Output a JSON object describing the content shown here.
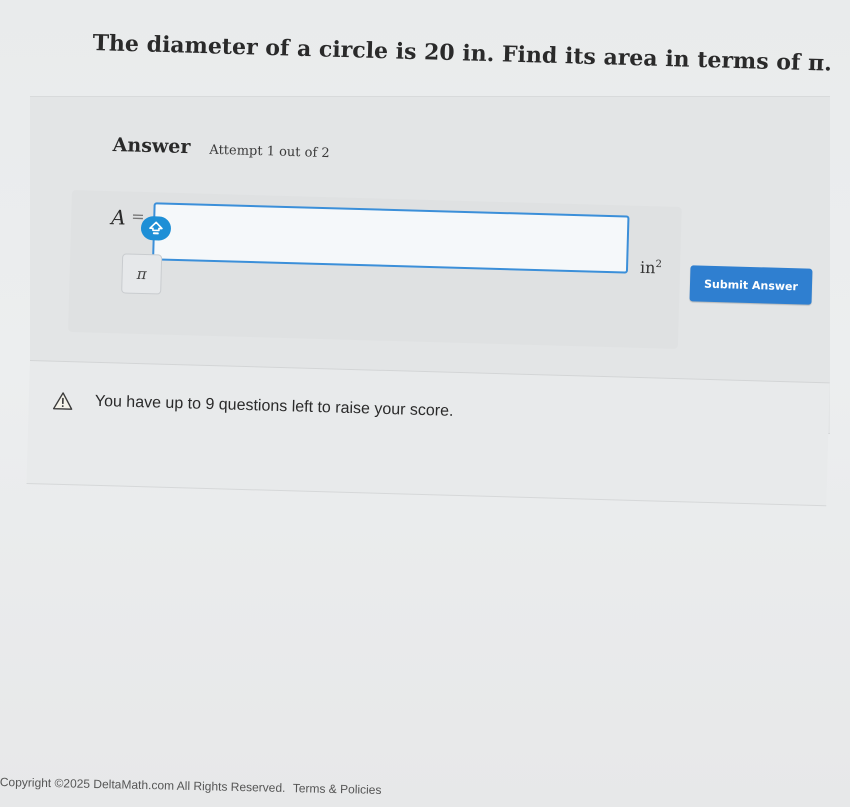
{
  "question": {
    "text": "The diameter of a circle is 20 in. Find its area in terms of π."
  },
  "answer_section": {
    "label": "Answer",
    "attempt": "Attempt 1 out of 2",
    "variable": "A",
    "equals": "=",
    "input_value": "",
    "pi_button_label": "π",
    "unit_base": "in",
    "unit_exponent": "2",
    "submit_label": "Submit Answer",
    "keyboard_icon": "keyboard-toggle-icon"
  },
  "notice": {
    "icon": "warning-triangle-icon",
    "text": "You have up to 9 questions left to raise your score."
  },
  "footer": {
    "copyright": "Copyright ©2025 DeltaMath.com All Rights Reserved.",
    "terms_link": "Terms & Policies"
  },
  "colors": {
    "accent": "#2f7fd0",
    "input_border": "#3b8fd9",
    "toggle": "#1e8fd6"
  }
}
